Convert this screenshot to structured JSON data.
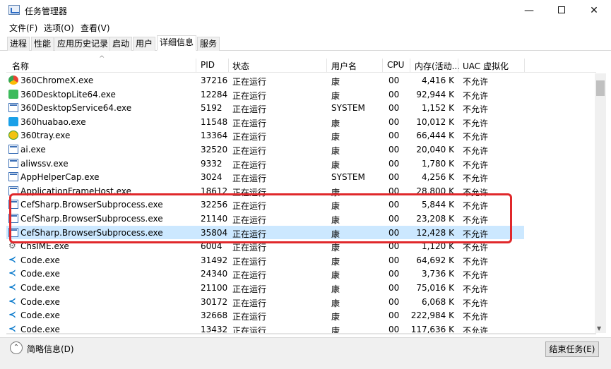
{
  "window": {
    "title": "任务管理器",
    "controls": {
      "minimize": "—",
      "close": "✕"
    }
  },
  "menu": [
    "文件(F)",
    "选项(O)",
    "查看(V)"
  ],
  "tabs": [
    "进程",
    "性能",
    "应用历史记录",
    "启动",
    "用户",
    "详细信息",
    "服务"
  ],
  "active_tab": "详细信息",
  "columns": [
    "名称",
    "PID",
    "状态",
    "用户名",
    "CPU",
    "内存(活动...",
    "UAC 虚拟化"
  ],
  "rows": [
    {
      "icon": "color-circle-icon",
      "name": "360ChromeX.exe",
      "pid": "37216",
      "status": "正在运行",
      "user": "康",
      "cpu": "00",
      "mem": "4,416 K",
      "uac": "不允许"
    },
    {
      "icon": "green-square-icon",
      "name": "360DesktopLite64.exe",
      "pid": "12284",
      "status": "正在运行",
      "user": "康",
      "cpu": "00",
      "mem": "92,944 K",
      "uac": "不允许"
    },
    {
      "icon": "exe-icon",
      "name": "360DesktopService64.exe",
      "pid": "5192",
      "status": "正在运行",
      "user": "SYSTEM",
      "cpu": "00",
      "mem": "1,152 K",
      "uac": "不允许"
    },
    {
      "icon": "blue-square-icon",
      "name": "360huabao.exe",
      "pid": "11548",
      "status": "正在运行",
      "user": "康",
      "cpu": "00",
      "mem": "10,012 K",
      "uac": "不允许"
    },
    {
      "icon": "tray-icon",
      "name": "360tray.exe",
      "pid": "13364",
      "status": "正在运行",
      "user": "康",
      "cpu": "00",
      "mem": "66,444 K",
      "uac": "不允许"
    },
    {
      "icon": "exe-icon",
      "name": "ai.exe",
      "pid": "32520",
      "status": "正在运行",
      "user": "康",
      "cpu": "00",
      "mem": "20,040 K",
      "uac": "不允许"
    },
    {
      "icon": "exe-icon",
      "name": "aliwssv.exe",
      "pid": "9332",
      "status": "正在运行",
      "user": "康",
      "cpu": "00",
      "mem": "1,780 K",
      "uac": "不允许"
    },
    {
      "icon": "exe-icon",
      "name": "AppHelperCap.exe",
      "pid": "3024",
      "status": "正在运行",
      "user": "SYSTEM",
      "cpu": "00",
      "mem": "4,256 K",
      "uac": "不允许"
    },
    {
      "icon": "exe-icon",
      "name": "ApplicationFrameHost.exe",
      "pid": "18612",
      "status": "正在运行",
      "user": "康",
      "cpu": "00",
      "mem": "28,800 K",
      "uac": "不允许"
    },
    {
      "icon": "exe-icon",
      "name": "CefSharp.BrowserSubprocess.exe",
      "pid": "32256",
      "status": "正在运行",
      "user": "康",
      "cpu": "00",
      "mem": "5,844 K",
      "uac": "不允许"
    },
    {
      "icon": "exe-icon",
      "name": "CefSharp.BrowserSubprocess.exe",
      "pid": "21140",
      "status": "正在运行",
      "user": "康",
      "cpu": "00",
      "mem": "23,208 K",
      "uac": "不允许"
    },
    {
      "icon": "exe-icon",
      "name": "CefSharp.BrowserSubprocess.exe",
      "pid": "35804",
      "status": "正在运行",
      "user": "康",
      "cpu": "00",
      "mem": "12,428 K",
      "uac": "不允许",
      "selected": true
    },
    {
      "icon": "gear-icon",
      "name": "ChsIME.exe",
      "pid": "6004",
      "status": "正在运行",
      "user": "康",
      "cpu": "00",
      "mem": "1,120 K",
      "uac": "不允许"
    },
    {
      "icon": "code-icon",
      "name": "Code.exe",
      "pid": "31492",
      "status": "正在运行",
      "user": "康",
      "cpu": "00",
      "mem": "64,692 K",
      "uac": "不允许"
    },
    {
      "icon": "code-icon",
      "name": "Code.exe",
      "pid": "24340",
      "status": "正在运行",
      "user": "康",
      "cpu": "00",
      "mem": "3,736 K",
      "uac": "不允许"
    },
    {
      "icon": "code-icon",
      "name": "Code.exe",
      "pid": "21100",
      "status": "正在运行",
      "user": "康",
      "cpu": "00",
      "mem": "75,016 K",
      "uac": "不允许"
    },
    {
      "icon": "code-icon",
      "name": "Code.exe",
      "pid": "30172",
      "status": "正在运行",
      "user": "康",
      "cpu": "00",
      "mem": "6,068 K",
      "uac": "不允许"
    },
    {
      "icon": "code-icon",
      "name": "Code.exe",
      "pid": "32668",
      "status": "正在运行",
      "user": "康",
      "cpu": "00",
      "mem": "222,984 K",
      "uac": "不允许"
    },
    {
      "icon": "code-icon",
      "name": "Code.exe",
      "pid": "13432",
      "status": "正在运行",
      "user": "康",
      "cpu": "00",
      "mem": "117,636 K",
      "uac": "不允许"
    }
  ],
  "footer": {
    "fewer_details": "简略信息(D)",
    "end_task": "结束任务(E)"
  },
  "colors": {
    "selected_row": "#cce8ff",
    "highlight_box": "#e0282b"
  }
}
